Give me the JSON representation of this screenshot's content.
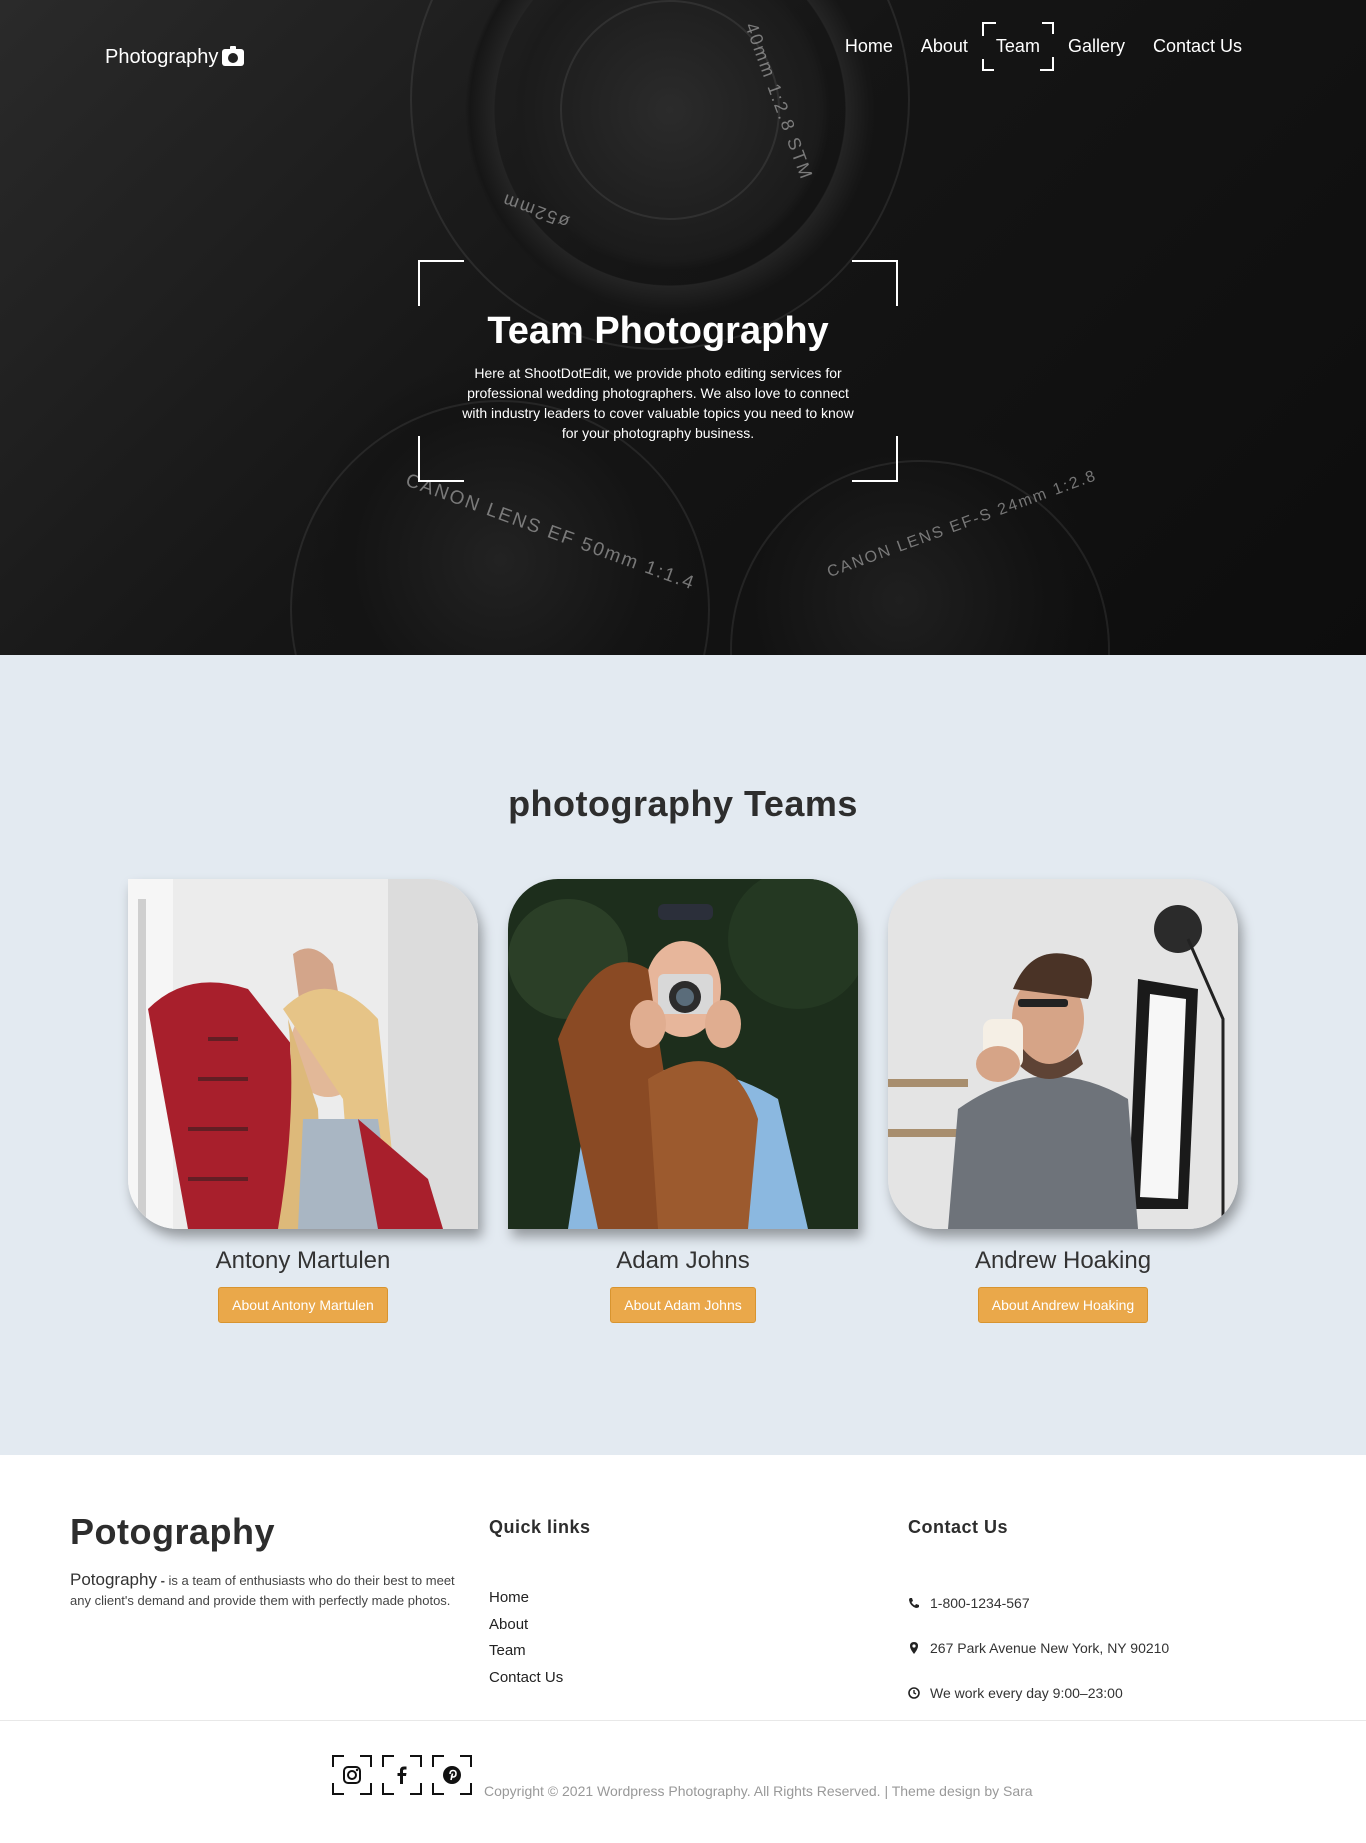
{
  "header": {
    "logo_text": "Photography",
    "nav": [
      {
        "label": "Home"
      },
      {
        "label": "About"
      },
      {
        "label": "Team"
      },
      {
        "label": "Gallery"
      },
      {
        "label": "Contact Us"
      }
    ],
    "active_nav": "Team"
  },
  "hero": {
    "title": "Team Photography",
    "text": "Here at ShootDotEdit, we provide photo editing services for professional wedding photographers. We also love to connect with industry leaders to cover valuable topics you need to know for your photography business.",
    "lens_labels": [
      "40mm 1:2.8 STM",
      "ø52mm",
      "CANON LENS EF 50mm 1:1.4",
      "CANON LENS EF-S 24mm 1:2.8"
    ]
  },
  "team": {
    "heading": "photography Teams",
    "members": [
      {
        "name": "Antony Martulen",
        "button": "About Antony Martulen"
      },
      {
        "name": "Adam Johns",
        "button": "About Adam Johns"
      },
      {
        "name": "Andrew Hoaking",
        "button": "About Andrew Hoaking"
      }
    ]
  },
  "footer": {
    "brand": "Potography",
    "desc_lead": "Potography",
    "desc_sep": " - ",
    "desc_text": "is a team of enthusiasts who do their best to meet any client's demand and provide them with perfectly made photos.",
    "quick_links_title": "Quick links",
    "quick_links": [
      "Home",
      "About",
      "Team",
      "Contact Us"
    ],
    "contact_title": "Contact Us",
    "contact": {
      "phone": "1-800-1234-567",
      "address": "267 Park Avenue New York, NY 90210",
      "hours": "We work every day 9:00–23:00"
    },
    "copyright": "Copyright © 2021 Wordpress Photography. All Rights Reserved. | Theme design by Sara",
    "socials": [
      "instagram-icon",
      "facebook-icon",
      "pinterest-icon"
    ]
  },
  "colors": {
    "accent": "#eaa84a",
    "team_bg": "#e3eaf1"
  }
}
